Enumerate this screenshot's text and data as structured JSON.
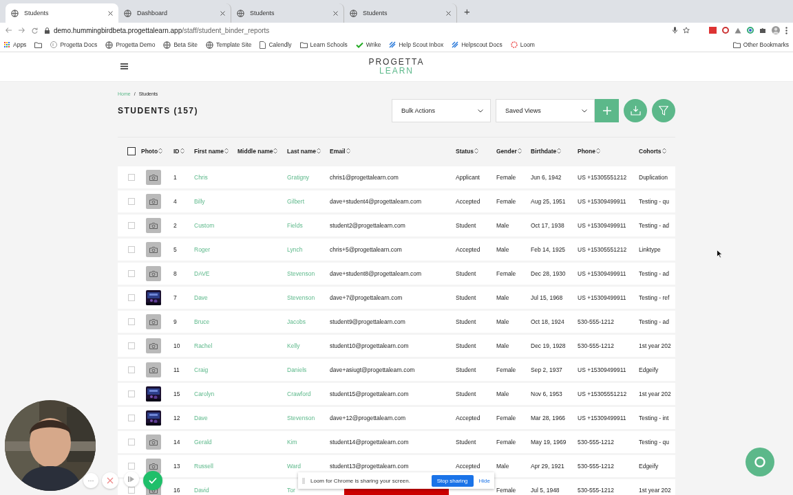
{
  "browser": {
    "tabs": [
      {
        "title": "Students",
        "selected": true
      },
      {
        "title": "Dashboard",
        "selected": false
      },
      {
        "title": "Students",
        "selected": false
      },
      {
        "title": "Students",
        "selected": false
      }
    ],
    "new_tab": "+",
    "address": "demo.hummingbirdbeta.progettalearn.app",
    "address_path": "/staff/student_binder_reports",
    "bookmarks": [
      {
        "kind": "apps",
        "label": "Apps"
      },
      {
        "kind": "folder"
      },
      {
        "kind": "page",
        "label": "Progetta Docs"
      },
      {
        "kind": "globe",
        "label": "Progetta Demo"
      },
      {
        "kind": "globe",
        "label": "Beta Site"
      },
      {
        "kind": "globe",
        "label": "Template Site"
      },
      {
        "kind": "doc",
        "label": "Calendly"
      },
      {
        "kind": "folder",
        "label": "Learn Schools"
      },
      {
        "kind": "check",
        "label": "Wrike"
      },
      {
        "kind": "slash",
        "label": "Help Scout Inbox"
      },
      {
        "kind": "slash",
        "label": "Helpscout Docs"
      },
      {
        "kind": "loom",
        "label": "Loom"
      }
    ],
    "other_bookmarks": "Other Bookmarks"
  },
  "header": {
    "logo_top": "PROGETTA",
    "logo_bottom": "LEARN"
  },
  "breadcrumb": [
    {
      "label": "Home",
      "link": true
    },
    {
      "label": "Students",
      "link": false
    }
  ],
  "breadcrumb_sep": "/",
  "title": "STUDENTS (157)",
  "toolbar": {
    "bulk_actions": "Bulk Actions",
    "saved_views": "Saved Views"
  },
  "table": {
    "select_all_checked": false,
    "columns": [
      "Photo",
      "ID",
      "First name",
      "Middle name",
      "Last name",
      "Email",
      "Status",
      "Gender",
      "Birthdate",
      "Phone",
      "Cohorts"
    ],
    "rows": [
      {
        "checked": false,
        "photo": {
          "kind": "placeholder"
        },
        "id": "1",
        "first": "Chris",
        "last": "Gratigny",
        "email": "chris1@progettalearn.com",
        "status": "Applicant",
        "gender": "Female",
        "birthdate": "Jun 6, 1942",
        "phone": "US +15305551212",
        "cohorts": "Duplication"
      },
      {
        "checked": false,
        "photo": {
          "kind": "placeholder"
        },
        "id": "4",
        "first": "Billy",
        "last": "Gilbert",
        "email": "dave+student4@progettalearn.com",
        "status": "Accepted",
        "gender": "Female",
        "birthdate": "Aug 25, 1951",
        "phone": "US +15309499911",
        "cohorts": "Testing - qu"
      },
      {
        "checked": false,
        "photo": {
          "kind": "placeholder"
        },
        "id": "2",
        "first": "Custom",
        "last": "Fields",
        "email": "student2@progettalearn.com",
        "status": "Student",
        "gender": "Male",
        "birthdate": "Oct 17, 1938",
        "phone": "US +15309499911",
        "cohorts": "Testing - ad"
      },
      {
        "checked": false,
        "photo": {
          "kind": "placeholder"
        },
        "id": "5",
        "first": "Roger",
        "last": "Lynch",
        "email": "chris+5@progettalearn.com",
        "status": "Accepted",
        "gender": "Male",
        "birthdate": "Feb 14, 1925",
        "phone": "US +15305551212",
        "cohorts": "Linktype"
      },
      {
        "checked": false,
        "photo": {
          "kind": "placeholder"
        },
        "id": "8",
        "first": "DAVE",
        "last": "Stevenson",
        "email": "dave+student8@progettalearn.com",
        "status": "Student",
        "gender": "Female",
        "birthdate": "Dec 28, 1930",
        "phone": "US +15309499911",
        "cohorts": "Testing - ad"
      },
      {
        "checked": false,
        "id": "7",
        "first": "Dave",
        "last": "Stevenson",
        "email": "dave+7@progettalearn.com",
        "status": "Student",
        "gender": "Male",
        "birthdate": "Jul 15, 1968",
        "phone": "US +15309499911",
        "cohorts": "Testing - ref"
      },
      {
        "checked": false,
        "photo": {
          "kind": "placeholder"
        },
        "id": "9",
        "first": "Bruce",
        "last": "Jacobs",
        "email": "student9@progettalearn.com",
        "status": "Student",
        "gender": "Male",
        "birthdate": "Oct 18, 1924",
        "phone": "530-555-1212",
        "cohorts": "Testing - ad"
      },
      {
        "checked": false,
        "photo": {
          "kind": "placeholder"
        },
        "id": "10",
        "first": "Rachel",
        "last": "Kelly",
        "email": "student10@progettalearn.com",
        "status": "Student",
        "gender": "Male",
        "birthdate": "Dec 19, 1928",
        "phone": "530-555-1212",
        "cohorts": "1st year 202"
      },
      {
        "checked": false,
        "photo": {
          "kind": "placeholder"
        },
        "id": "11",
        "first": "Craig",
        "last": "Daniels",
        "email": "dave+asiugt@progettalearn.com",
        "status": "Student",
        "gender": "Female",
        "birthdate": "Sep 2, 1937",
        "phone": "US +15309499911",
        "cohorts": "Edgeify"
      },
      {
        "checked": false,
        "id": "15",
        "first": "Carolyn",
        "last": "Crawford",
        "email": "student15@progettalearn.com",
        "status": "Student",
        "gender": "Male",
        "birthdate": "Nov 6, 1953",
        "phone": "US +15305551212",
        "cohorts": "1st year 202"
      },
      {
        "checked": false,
        "id": "12",
        "first": "Dave",
        "last": "Stevenson",
        "email": "dave+12@progettalearn.com",
        "status": "Accepted",
        "gender": "Female",
        "birthdate": "Mar 28, 1966",
        "phone": "US +15309499911",
        "cohorts": "Testing - int"
      },
      {
        "checked": false,
        "photo": {
          "kind": "placeholder"
        },
        "id": "14",
        "first": "Gerald",
        "last": "Kim",
        "email": "student14@progettalearn.com",
        "status": "Student",
        "gender": "Female",
        "birthdate": "May 19, 1969",
        "phone": "530-555-1212",
        "cohorts": "Testing - qu"
      },
      {
        "checked": false,
        "photo": {
          "kind": "placeholder"
        },
        "id": "13",
        "first": "Russell",
        "last": "Ward",
        "email": "student13@progettalearn.com",
        "status": "Accepted",
        "gender": "Male",
        "birthdate": "Apr 29, 1921",
        "phone": "530-555-1212",
        "cohorts": "Edgeify"
      },
      {
        "checked": false,
        "photo": {
          "kind": "placeholder"
        },
        "id": "16",
        "first": "David",
        "last": "Tor",
        "gender": "Female",
        "birthdate": "Jul 5, 1948",
        "phone": "530-555-1212",
        "cohorts": "1st year 202"
      }
    ]
  },
  "loom": {
    "message": "Loom for Chrome is sharing your screen.",
    "stop": "Stop sharing",
    "hide": "Hide",
    "more": "···"
  }
}
